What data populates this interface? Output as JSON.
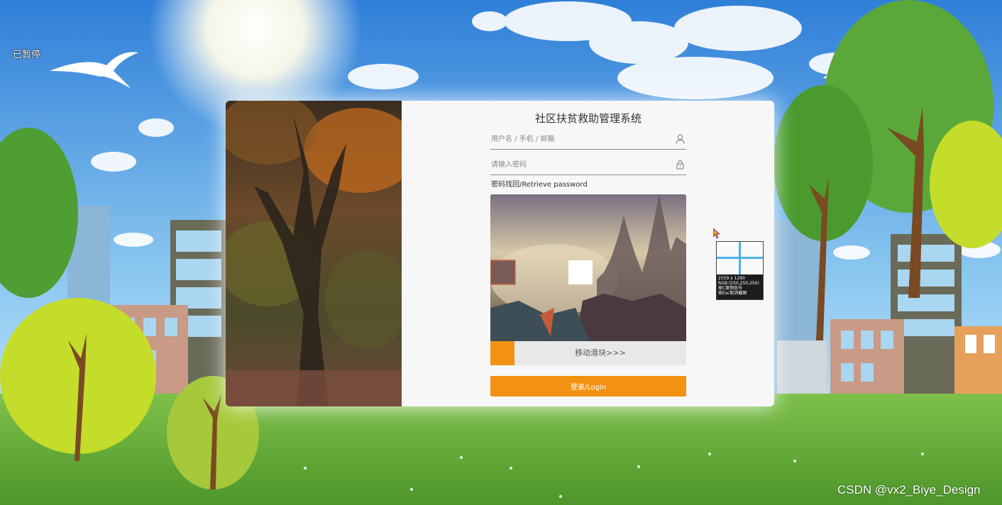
{
  "status": {
    "paused_label": "已暂停"
  },
  "login": {
    "title": "社区扶贫救助管理系统",
    "username_placeholder": "用户名 / 手机 / 邮箱",
    "password_placeholder": "请输入密码",
    "retrieve_link": "密码找回/Retrieve password",
    "slider_text": "移动滑块>>>",
    "login_button": "登录/Login"
  },
  "magnifier": {
    "size_text": "2559 x 1290",
    "rgb_text": "RGB:(250,250,250)",
    "hint1": "按C复制色号",
    "hint2": "按Esc取消截图"
  },
  "watermark": "CSDN @vx2_Biye_Design",
  "icons": {
    "user": "user-icon",
    "lock": "lock-icon",
    "cursor": "mouse-cursor-icon"
  },
  "colors": {
    "accent": "#f39212",
    "sky": "#3a86d8",
    "grass": "#5fa83a",
    "magnifier_cross": "#4ab3ea"
  }
}
